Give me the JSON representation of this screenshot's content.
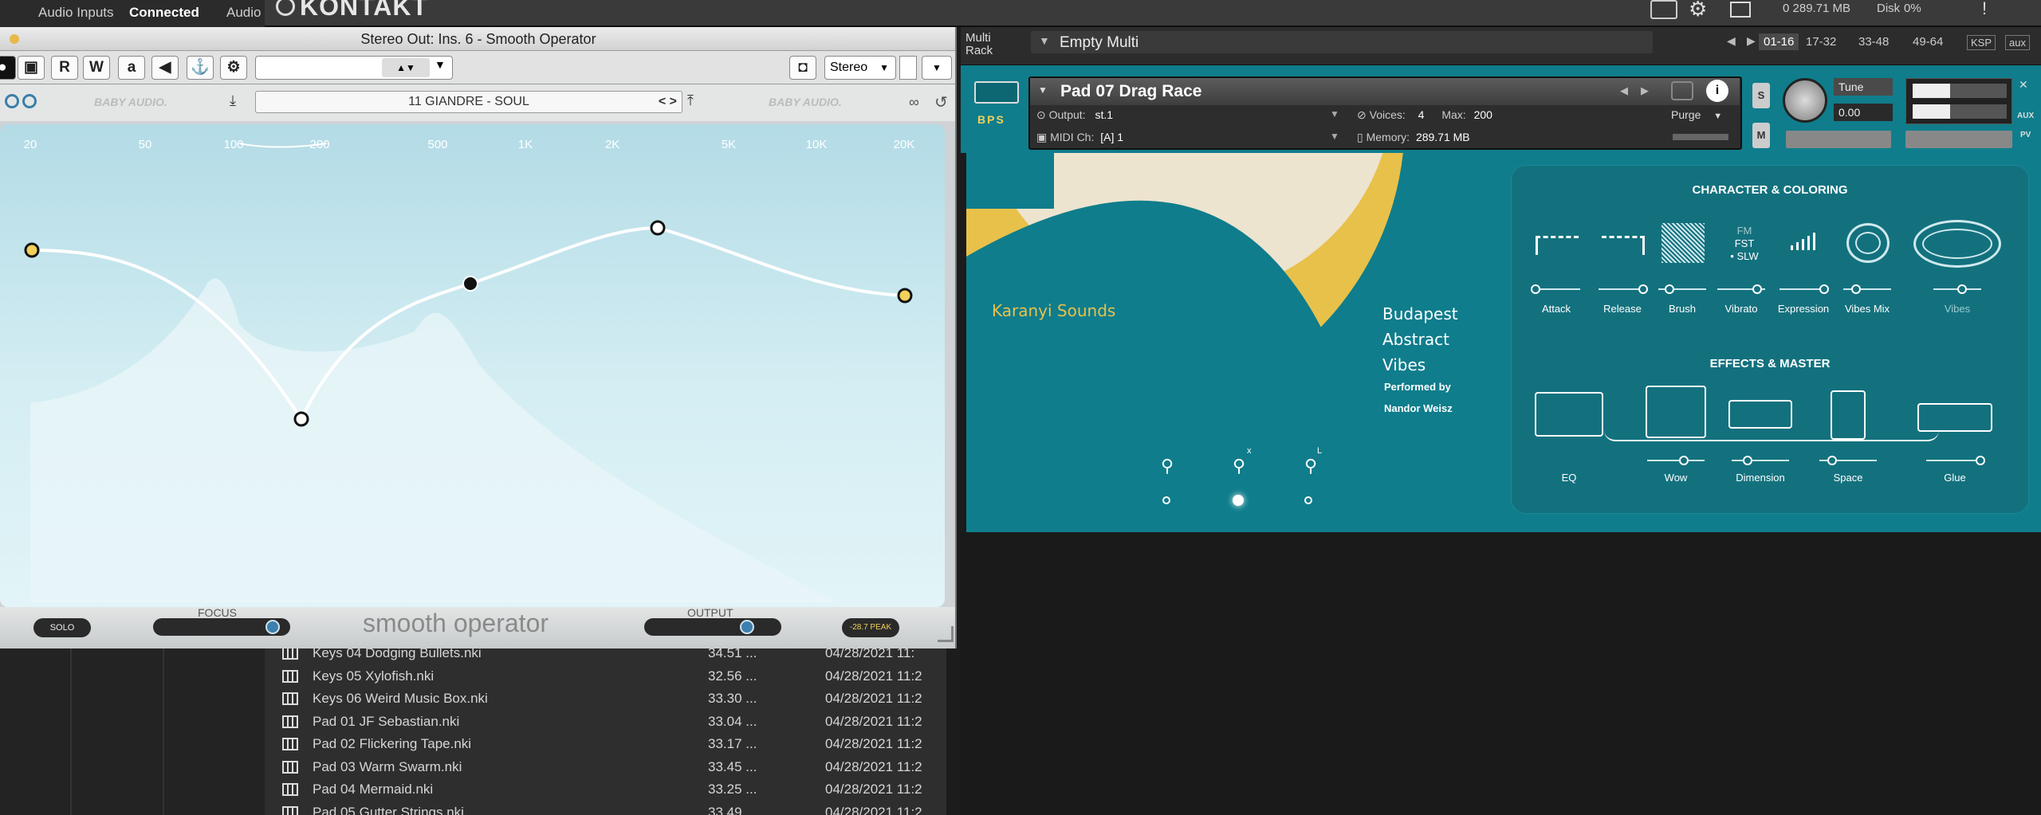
{
  "host": {
    "audio_inputs": "Audio Inputs",
    "connected": "Connected",
    "audio": "Audio"
  },
  "kontakt": {
    "logo": "KONTAKT",
    "cpu_mem": "0  289.71 MB",
    "disk": "Disk",
    "disk_val": "0%"
  },
  "plugin": {
    "window_title": "Stereo Out: Ins. 6 - Smooth Operator",
    "toolbar": {
      "r": "R",
      "w": "W",
      "a": "a",
      "stereo": "Stereo"
    },
    "brand_left": "BABY AUDIO.",
    "brand_right": "BABY AUDIO.",
    "preset": "11 GIANDRE - SOUL",
    "freq_labels": [
      "20",
      "50",
      "100",
      "200",
      "500",
      "1K",
      "2K",
      "5K",
      "10K",
      "20K"
    ],
    "focus_label": "FOCUS",
    "output_label": "OUTPUT",
    "name": "smooth operator",
    "solo": "SOLO",
    "peak": "-28.7 PEAK",
    "eq_points": [
      {
        "freq": "20"
      },
      {
        "freq": "~180"
      },
      {
        "freq": "~650"
      },
      {
        "freq": "~3.1K"
      },
      {
        "freq": "~17K"
      }
    ],
    "focus_value": 0.94,
    "output_value": 0.8
  },
  "browser": {
    "rows": [
      {
        "name": "Keys 04 Dodging Bullets.nki",
        "size": "34.51 ...",
        "date": "04/28/2021 11:"
      },
      {
        "name": "Keys 05 Xylofish.nki",
        "size": "32.56 ...",
        "date": "04/28/2021 11:2"
      },
      {
        "name": "Keys 06 Weird Music Box.nki",
        "size": "33.30 ...",
        "date": "04/28/2021 11:2"
      },
      {
        "name": "Pad 01 JF Sebastian.nki",
        "size": "33.04 ...",
        "date": "04/28/2021 11:2"
      },
      {
        "name": "Pad 02 Flickering Tape.nki",
        "size": "33.17 ...",
        "date": "04/28/2021 11:2"
      },
      {
        "name": "Pad 03 Warm Swarm.nki",
        "size": "33.45 ...",
        "date": "04/28/2021 11:2"
      },
      {
        "name": "Pad 04 Mermaid.nki",
        "size": "33.25 ...",
        "date": "04/28/2021 11:2"
      },
      {
        "name": "Pad 05 Gutter Strings.nki",
        "size": "33.49 ...",
        "date": "04/28/2021 11:2"
      }
    ]
  },
  "rack": {
    "label1": "Multi",
    "label2": "Rack",
    "multi_name": "Empty Multi",
    "ranges": [
      "01-16",
      "17-32",
      "33-48",
      "49-64",
      "KSP"
    ],
    "aux": "aux"
  },
  "instrument": {
    "name": "Pad 07 Drag Race",
    "output_label": "Output:",
    "output": "st.1",
    "voices_label": "Voices:",
    "voices": "4",
    "max_label": "Max:",
    "max": "200",
    "purge": "Purge",
    "midi_label": "MIDI Ch:",
    "midi": "[A]  1",
    "memory_label": "Memory:",
    "memory": "289.71 MB",
    "tune_label": "Tune",
    "tune": "0.00",
    "s": "S",
    "m": "M",
    "bps": "BPS",
    "aux": "AUX",
    "pv": "PV"
  },
  "panel": {
    "karanyi": "Karanyi Sounds",
    "title_lines": [
      "Budapest",
      "Abstract",
      "Vibes"
    ],
    "performed": "Performed by",
    "performer": "Nandor Weisz",
    "character_title": "CHARACTER & COLORING",
    "character": [
      "Attack",
      "Release",
      "Brush",
      "Vibrato",
      "Expression",
      "Vibes Mix",
      "Vibes"
    ],
    "vibrato_modes": [
      "FM",
      "FST",
      "SLW"
    ],
    "effects_title": "EFFECTS & MASTER",
    "effects": [
      "EQ",
      "Wow",
      "Dimension",
      "Space",
      "Glue"
    ],
    "mic_marks": [
      "x",
      "L"
    ]
  },
  "colors": {
    "teal": "#0f7d8c",
    "yellow": "#e8c14a",
    "cream": "#ece4cf",
    "eq_bg": "#b3dbe6"
  }
}
